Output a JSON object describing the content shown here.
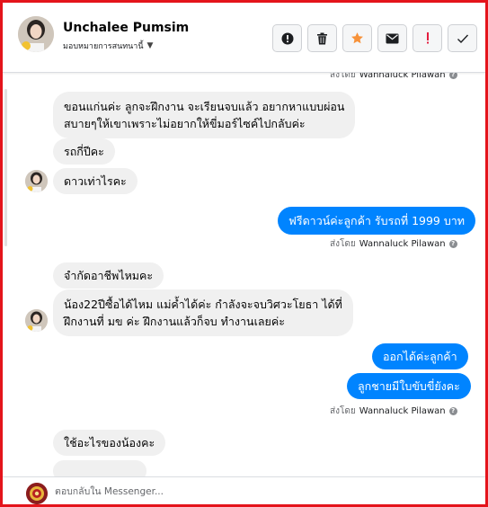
{
  "header": {
    "contact_name": "Unchalee Pumsim",
    "assign_label": "มอบหมายการสนทนานี้",
    "actions": [
      "alert-icon",
      "trash-icon",
      "star-icon",
      "envelope-icon",
      "exclamation-icon",
      "check-icon"
    ],
    "star_color": "#f7923a",
    "exclamation_color": "#e41e3f"
  },
  "messages": {
    "sent_by_prefix": "ส่งโดย",
    "agent_name": "Wannaluck Pilawan",
    "top_sent_by_prefix": "ส่งโดย",
    "top_agent_name": "Wannaluck Pilawan",
    "in1_line1": "ขอนแก่นค่ะ ลูกจะฝึกงาน จะเรียนจบแล้ว อยากหาแบบผ่อน",
    "in1_line2": "สบายๆให้เขาเพราะไม่อยากให้ขี่มอร์ไซค์ไปกลับค่ะ",
    "in2": "รถกี่ปีคะ",
    "in3": "ดาวเท่าไรคะ",
    "out1": "ฟรีดาวน์ค่ะลูกค้า  รับรถที่ 1999 บาท",
    "in4": "จำกัดอาชีพไหมคะ",
    "in5_line1": "น้อง22ปีซื้อได้ไหม แม่ค้ำได้ค่ะ  กำลังจะจบวิศวะโยธา ได้ที่",
    "in5_line2": "ฝึกงานที่ มข ค่ะ ฝึกงานแล้วก็จบ ทำงานเลยค่ะ",
    "out2": "ออกได้ค่ะลูกค้า",
    "out3": "ลูกชายมีใบขับขี่ยังคะ",
    "in6": "ใช้อะไรของน้องคะ"
  },
  "composer": {
    "placeholder": "ตอบกลับใน Messenger..."
  },
  "colors": {
    "outgoing_bubble": "#0084ff",
    "incoming_bubble": "#f0f0f0",
    "frame_border": "#e4141b"
  }
}
